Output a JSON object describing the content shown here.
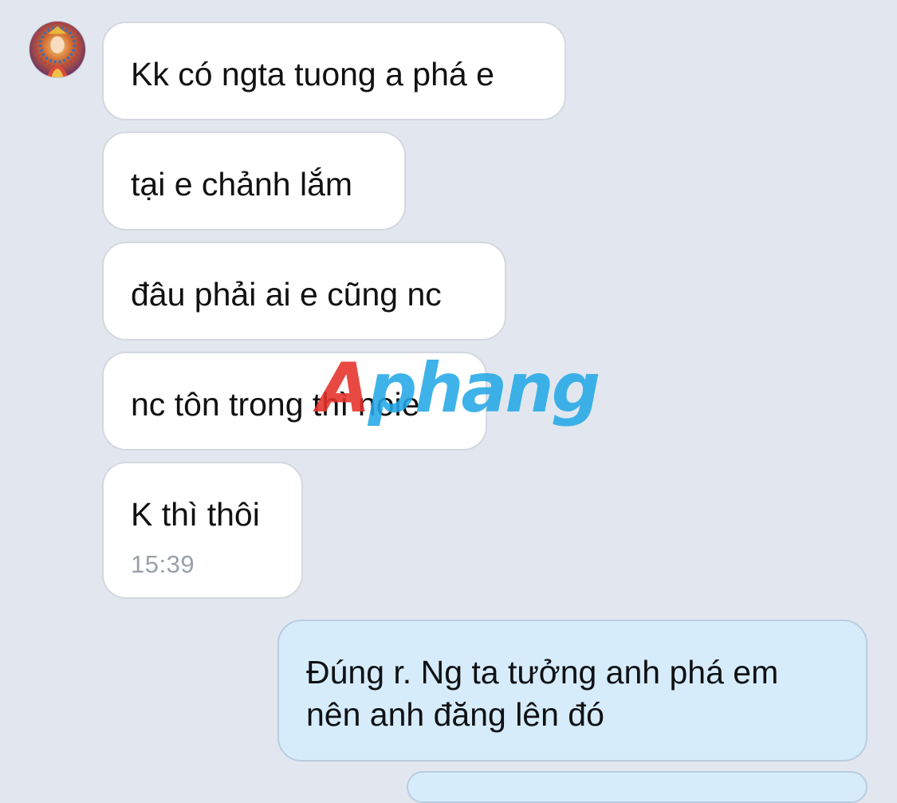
{
  "conversation": {
    "incoming": [
      {
        "text": "Kk có ngta tuong a phá e"
      },
      {
        "text": "tại e chảnh lắm"
      },
      {
        "text": "đâu phải ai e cũng nc"
      },
      {
        "text": "nc tôn trong thì noie"
      },
      {
        "text": "K thì thôi",
        "time": "15:39"
      }
    ],
    "outgoing": [
      {
        "text": "Đúng r. Ng ta tưởng anh phá em nên anh đăng lên đó"
      }
    ]
  },
  "watermark": {
    "first_letter": "A",
    "rest": "phang"
  },
  "colors": {
    "background": "#e2e7ef",
    "incoming_bubble": "#ffffff",
    "outgoing_bubble": "#d6ecfb",
    "timestamp": "#9aa0a8",
    "watermark_red": "#e6312a",
    "watermark_blue": "#25a9e6"
  }
}
